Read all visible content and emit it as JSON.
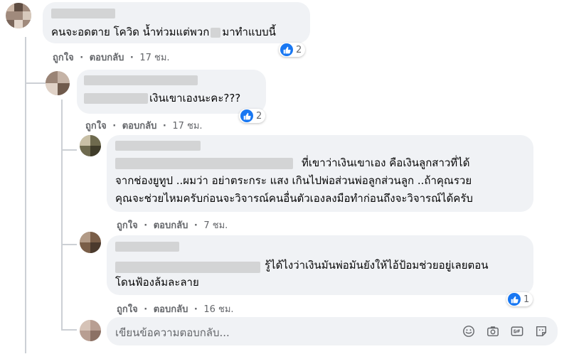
{
  "comments": [
    {
      "text_lines": [
        "คนจะอดตาย โควิด น้ำท่วมแต่พวก",
        "มาทำแบบนี้"
      ],
      "like_label": "ถูกใจ",
      "reply_label": "ตอบกลับ",
      "time": "17 ชม.",
      "reactions": "2"
    },
    {
      "text_lines": [
        "เงินเขาเองนะคะ???"
      ],
      "like_label": "ถูกใจ",
      "reply_label": "ตอบกลับ",
      "time": "17 ชม.",
      "reactions": "2"
    },
    {
      "text_lines": [
        "ที่เขาว่าเงินเขาเอง คือเงินลูกสาวที่ได้",
        "จากช่องยูทูป ..ผมว่า อย่าตระกระ แสง เกินไปพ่อส่วนพ่อลูกส่วนลูก ..ถ้าคุณรวย",
        "คุณจะช่วยไหมครับก่อนจะวิจารณ์คนอื่นตัวเองลงมือทำก่อนถึงจะวิจารณ์ได้ครับ"
      ],
      "like_label": "ถูกใจ",
      "reply_label": "ตอบกลับ",
      "time": "7 ชม."
    },
    {
      "text_lines": [
        "รู้ได้ไงว่าเงินมันพ่อมันยังให้ไอ้ป้อมช่วยอยู่เลยตอน",
        "โดนฟ้องล้มละลาย"
      ],
      "like_label": "ถูกใจ",
      "reply_label": "ตอบกลับ",
      "time": "16 ชม.",
      "reactions": "1"
    }
  ],
  "reply_input": {
    "placeholder": "เขียนข้อความตอบกลับ..."
  },
  "separator": "·",
  "colors": {
    "accent": "#1877f2",
    "bubble": "#f0f2f5",
    "meta": "#65676b"
  },
  "icons": [
    "like-icon",
    "emoji-icon",
    "camera-icon",
    "gif-icon",
    "sticker-icon"
  ]
}
